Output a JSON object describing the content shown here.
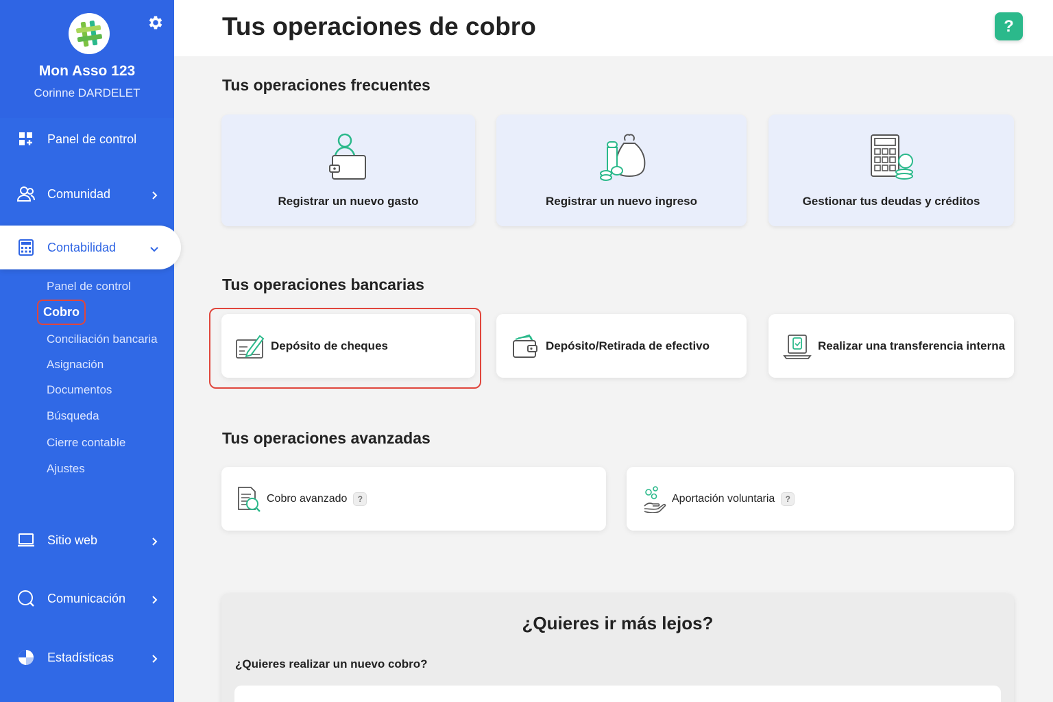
{
  "sidebar": {
    "org_name": "Mon Asso 123",
    "user_name": "Corinne DARDELET",
    "nav": {
      "panel": "Panel de control",
      "comunidad": "Comunidad",
      "contabilidad": "Contabilidad",
      "sitio_web": "Sitio web",
      "comunicacion": "Comunicación",
      "estadisticas": "Estadísticas"
    },
    "subnav": {
      "panel": "Panel de control",
      "cobro": "Cobro",
      "conciliacion": "Conciliación bancaria",
      "asignacion": "Asignación",
      "documentos": "Documentos",
      "busqueda": "Búsqueda",
      "cierre": "Cierre contable",
      "ajustes": "Ajustes"
    }
  },
  "header": {
    "title": "Tus operaciones de cobro",
    "help": "?"
  },
  "frequent": {
    "title": "Tus operaciones frecuentes",
    "gasto": "Registrar un nuevo gasto",
    "ingreso": "Registrar un nuevo ingreso",
    "deudas": "Gestionar tus deudas y créditos"
  },
  "bank": {
    "title": "Tus operaciones bancarias",
    "cheques": "Depósito de cheques",
    "efectivo": "Depósito/Retirada de efectivo",
    "transferencia": "Realizar una transferencia interna"
  },
  "advanced": {
    "title": "Tus operaciones avanzadas",
    "cobro": "Cobro avanzado",
    "aportacion": "Aportación voluntaria",
    "q": "?"
  },
  "more": {
    "title": "¿Quieres ir más lejos?",
    "question": "¿Quieres realizar un nuevo cobro?"
  },
  "colors": {
    "sidebar": "#3069e6",
    "accent_green": "#2bb98b",
    "highlight_red": "#e0463c",
    "card_light": "#e9eefb"
  },
  "icons": {
    "logo": "hashtag-logo-icon",
    "settings": "gear-icon",
    "help": "help-icon"
  }
}
